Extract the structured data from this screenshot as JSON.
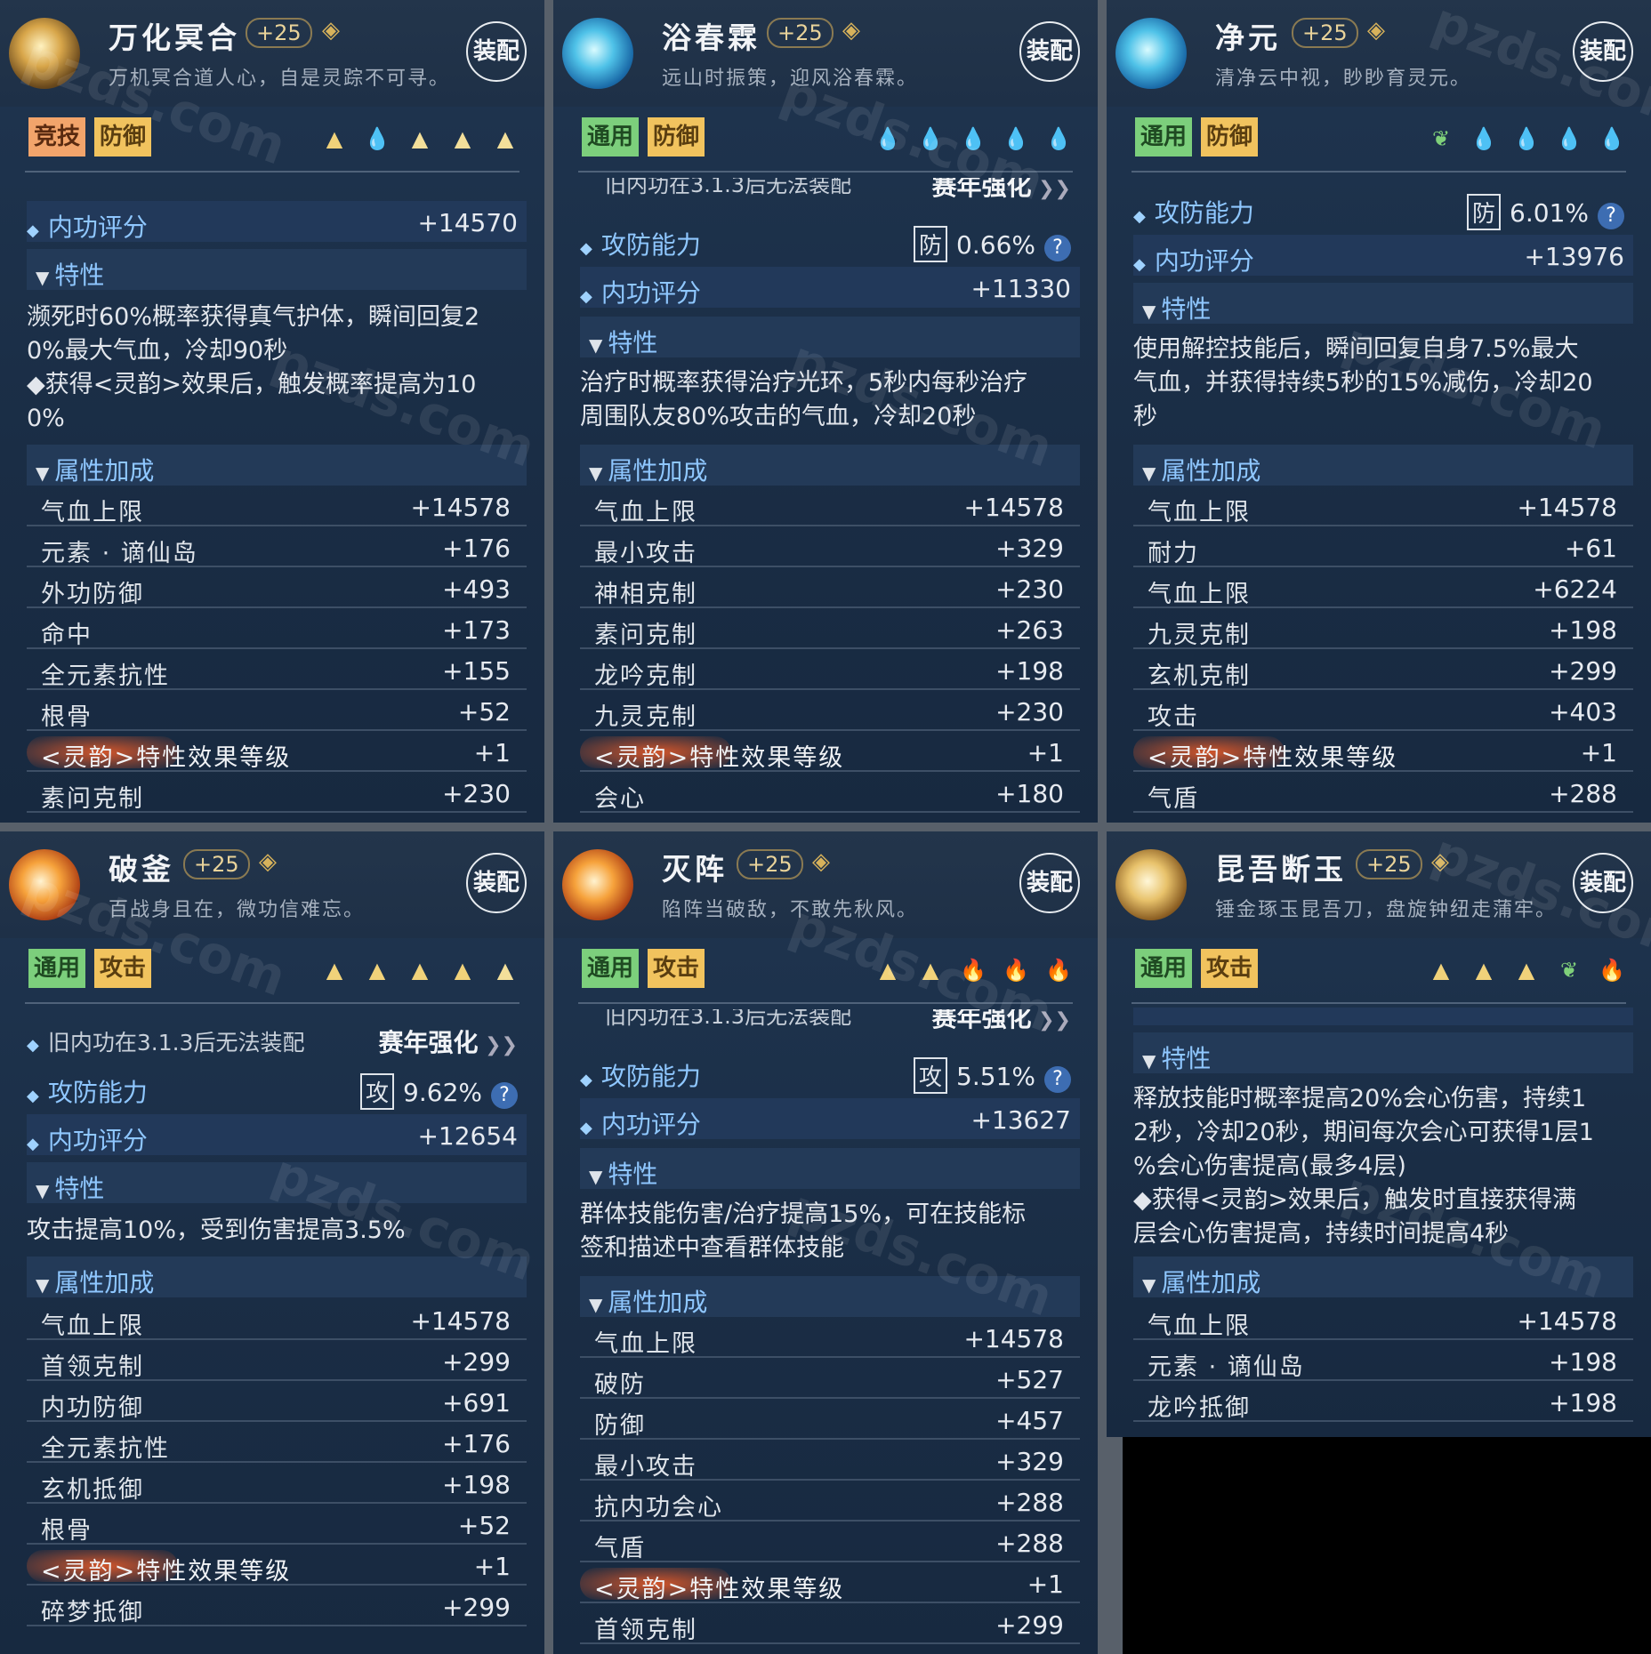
{
  "common": {
    "equip_label": "装配",
    "score_label": "内功评分",
    "trait_header": "特性",
    "attr_header": "属性加成",
    "atkdef_label": "攻防能力",
    "old_notice": "旧内功在3.1.3后无法装配",
    "season_label": "赛年强化",
    "lock_icon": "diamond-lock-icon",
    "watermark": "pzds.com",
    "lingyun_prefix": "<灵韵>",
    "lingyun_suffix": "特性效果等级"
  },
  "cards": [
    {
      "title": "万化冥合",
      "level": "+25",
      "quote": "万机冥合道人心，自是灵踪不可寻。",
      "tags": [
        "竞技",
        "防御"
      ],
      "icons": [
        "mountain-icon",
        "drop-icon",
        "mountain-icon",
        "mountain-icon",
        "mountain-icon"
      ],
      "score": "+14570",
      "trait_lines": [
        "濒死时60%概率获得真气护体，瞬间回复2",
        "0%最大气血，冷却90秒",
        "◆获得<灵韵>效果后，触发概率提高为10",
        "0%"
      ],
      "attrs": [
        {
          "label": "气血上限",
          "value": "+14578"
        },
        {
          "label": "元素 · 谪仙岛",
          "value": "+176"
        },
        {
          "label": "外功防御",
          "value": "+493"
        },
        {
          "label": "命中",
          "value": "+173"
        },
        {
          "label": "全元素抗性",
          "value": "+155"
        },
        {
          "label": "根骨",
          "value": "+52"
        },
        {
          "label": "<灵韵>特性效果等级",
          "value": "+1",
          "special": true
        },
        {
          "label": "素问克制",
          "value": "+230"
        }
      ]
    },
    {
      "title": "浴春霖",
      "level": "+25",
      "quote": "远山时振策，迎风浴春霖。",
      "tags": [
        "通用",
        "防御"
      ],
      "icons": [
        "drop-icon",
        "drop-icon",
        "drop-icon",
        "drop-icon",
        "drop-icon"
      ],
      "atkdef_type": "防",
      "atkdef_value": "0.66%",
      "score": "+11330",
      "trait_lines": [
        "治疗时概率获得治疗光环，5秒内每秒治疗",
        "周围队友80%攻击的气血，冷却20秒"
      ],
      "attrs": [
        {
          "label": "气血上限",
          "value": "+14578"
        },
        {
          "label": "最小攻击",
          "value": "+329"
        },
        {
          "label": "神相克制",
          "value": "+230"
        },
        {
          "label": "素问克制",
          "value": "+263"
        },
        {
          "label": "龙吟克制",
          "value": "+198"
        },
        {
          "label": "九灵克制",
          "value": "+230"
        },
        {
          "label": "<灵韵>特性效果等级",
          "value": "+1",
          "special": true
        },
        {
          "label": "会心",
          "value": "+180"
        }
      ]
    },
    {
      "title": "净元",
      "level": "+25",
      "quote": "清净云中视，眇眇育灵元。",
      "tags": [
        "通用",
        "防御"
      ],
      "icons": [
        "leaf-icon",
        "drop-icon",
        "drop-icon",
        "drop-icon",
        "drop-icon"
      ],
      "atkdef_type": "防",
      "atkdef_value": "6.01%",
      "score": "+13976",
      "trait_lines": [
        "使用解控技能后，瞬间回复自身7.5%最大",
        "气血，并获得持续5秒的15%减伤，冷却20",
        "秒"
      ],
      "attrs": [
        {
          "label": "气血上限",
          "value": "+14578"
        },
        {
          "label": "耐力",
          "value": "+61"
        },
        {
          "label": "气血上限",
          "value": "+6224"
        },
        {
          "label": "九灵克制",
          "value": "+198"
        },
        {
          "label": "玄机克制",
          "value": "+299"
        },
        {
          "label": "攻击",
          "value": "+403"
        },
        {
          "label": "<灵韵>特性效果等级",
          "value": "+1",
          "special": true
        },
        {
          "label": "气盾",
          "value": "+288"
        }
      ]
    },
    {
      "title": "破釜",
      "level": "+25",
      "quote": "百战身且在，微功信难忘。",
      "tags": [
        "通用",
        "攻击"
      ],
      "icons": [
        "mountain-icon",
        "mountain-icon",
        "mountain-icon",
        "mountain-icon",
        "mountain-icon"
      ],
      "atkdef_type": "攻",
      "atkdef_value": "9.62%",
      "score": "+12654",
      "trait_lines": [
        "攻击提高10%，受到伤害提高3.5%"
      ],
      "attrs": [
        {
          "label": "气血上限",
          "value": "+14578"
        },
        {
          "label": "首领克制",
          "value": "+299"
        },
        {
          "label": "内功防御",
          "value": "+691"
        },
        {
          "label": "全元素抗性",
          "value": "+176"
        },
        {
          "label": "玄机抵御",
          "value": "+198"
        },
        {
          "label": "根骨",
          "value": "+52"
        },
        {
          "label": "<灵韵>特性效果等级",
          "value": "+1",
          "special": true
        },
        {
          "label": "碎梦抵御",
          "value": "+299"
        }
      ]
    },
    {
      "title": "灭阵",
      "level": "+25",
      "quote": "陷阵当破敌，不敢先秋风。",
      "tags": [
        "通用",
        "攻击"
      ],
      "icons": [
        "mountain-icon",
        "mountain-icon",
        "fire-icon",
        "fire-icon",
        "fire-icon"
      ],
      "atkdef_type": "攻",
      "atkdef_value": "5.51%",
      "score": "+13627",
      "trait_lines": [
        "群体技能伤害/治疗提高15%，可在技能标",
        "签和描述中查看群体技能"
      ],
      "attrs": [
        {
          "label": "气血上限",
          "value": "+14578"
        },
        {
          "label": "破防",
          "value": "+527"
        },
        {
          "label": "防御",
          "value": "+457"
        },
        {
          "label": "最小攻击",
          "value": "+329"
        },
        {
          "label": "抗内功会心",
          "value": "+288"
        },
        {
          "label": "气盾",
          "value": "+288"
        },
        {
          "label": "<灵韵>特性效果等级",
          "value": "+1",
          "special": true
        },
        {
          "label": "首领克制",
          "value": "+299"
        }
      ]
    },
    {
      "title": "昆吾断玉",
      "level": "+25",
      "quote": "锤金琢玉昆吾刀，盘旋钟纽走蒲牢。",
      "tags": [
        "通用",
        "攻击"
      ],
      "icons": [
        "mountain-icon",
        "mountain-icon",
        "mountain-icon",
        "leaf-icon",
        "fire-icon"
      ],
      "trait_lines": [
        "释放技能时概率提高20%会心伤害，持续1",
        "2秒，冷却20秒，期间每次会心可获得1层1",
        "%会心伤害提高(最多4层)",
        "◆获得<灵韵>效果后，触发时直接获得满",
        "层会心伤害提高，持续时间提高4秒"
      ],
      "attrs": [
        {
          "label": "气血上限",
          "value": "+14578"
        },
        {
          "label": "元素 · 谪仙岛",
          "value": "+198"
        },
        {
          "label": "龙吟抵御",
          "value": "+198"
        }
      ]
    }
  ]
}
